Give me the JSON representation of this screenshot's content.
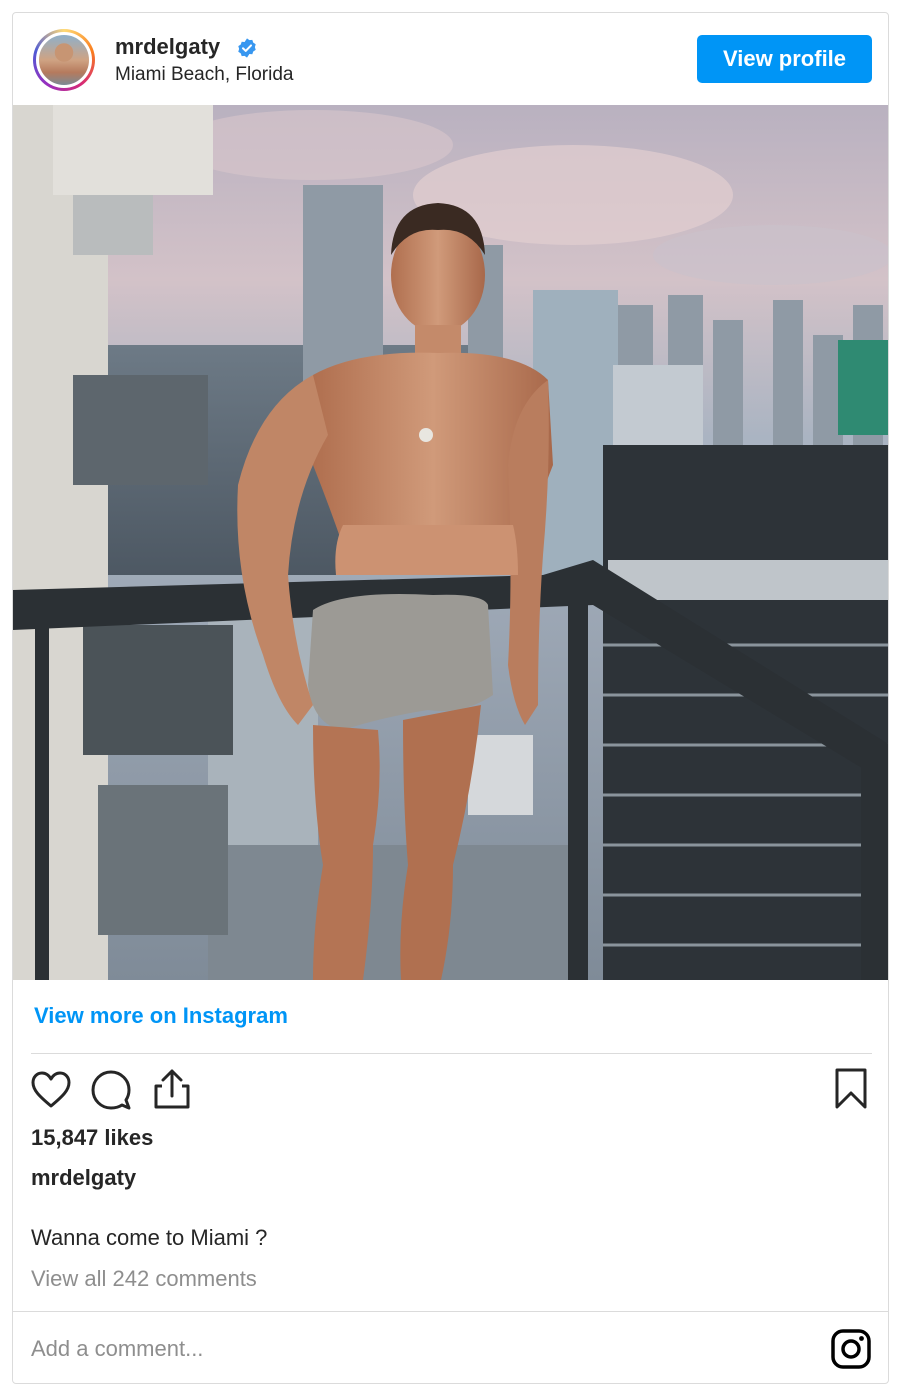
{
  "header": {
    "username": "mrdelgaty",
    "location": "Miami Beach, Florida",
    "view_profile_label": "View profile"
  },
  "post": {
    "view_more_label": "View more on Instagram",
    "likes": "15,847 likes",
    "caption_username": "mrdelgaty",
    "caption": "Wanna come to Miami ?",
    "view_comments": "View all 242 comments"
  },
  "comment_box": {
    "placeholder": "Add a comment..."
  },
  "icons": [
    "verified-badge-icon",
    "heart-icon",
    "comment-icon",
    "share-icon",
    "bookmark-icon",
    "instagram-icon"
  ],
  "colors": {
    "accent": "#0095f6",
    "text": "#262626",
    "muted": "#8e8e8e",
    "border": "#dbdbdb"
  }
}
